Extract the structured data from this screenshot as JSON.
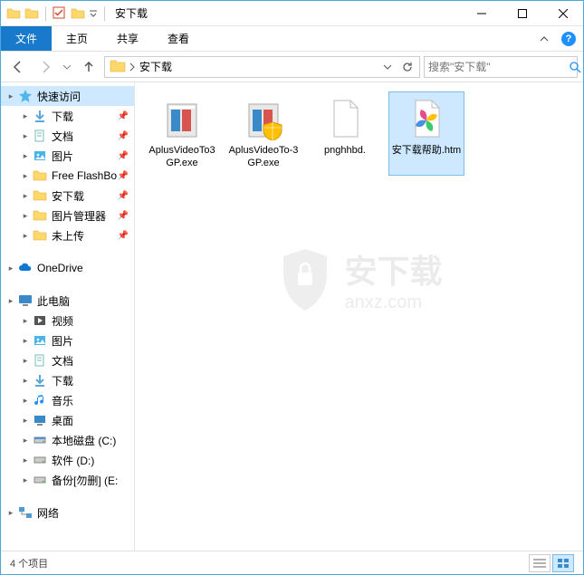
{
  "window": {
    "title": "安下载"
  },
  "ribbon": {
    "file": "文件",
    "home": "主页",
    "share": "共享",
    "view": "查看"
  },
  "address": {
    "path": "安下载",
    "search_placeholder": "搜索\"安下载\""
  },
  "sidebar": {
    "quick_access": "快速访问",
    "items_qa": [
      {
        "label": "下载",
        "icon": "download",
        "pinned": true
      },
      {
        "label": "文档",
        "icon": "documents",
        "pinned": true
      },
      {
        "label": "图片",
        "icon": "pictures",
        "pinned": true
      },
      {
        "label": "Free FlashBo",
        "icon": "folder",
        "pinned": true
      },
      {
        "label": "安下载",
        "icon": "folder",
        "pinned": true
      },
      {
        "label": "图片管理器",
        "icon": "folder",
        "pinned": true
      },
      {
        "label": "未上传",
        "icon": "folder",
        "pinned": true
      }
    ],
    "onedrive": "OneDrive",
    "this_pc": "此电脑",
    "items_pc": [
      {
        "label": "视频",
        "icon": "videos"
      },
      {
        "label": "图片",
        "icon": "pictures"
      },
      {
        "label": "文档",
        "icon": "documents"
      },
      {
        "label": "下载",
        "icon": "download"
      },
      {
        "label": "音乐",
        "icon": "music"
      },
      {
        "label": "桌面",
        "icon": "desktop"
      },
      {
        "label": "本地磁盘 (C:)",
        "icon": "drive-c"
      },
      {
        "label": "软件 (D:)",
        "icon": "drive"
      },
      {
        "label": "备份[勿删] (E:",
        "icon": "drive"
      }
    ],
    "network": "网络"
  },
  "files": [
    {
      "name": "AplusVideoTo3GP.exe",
      "type": "exe-installer"
    },
    {
      "name": "AplusVideoTo-3GP.exe",
      "type": "exe-installer-shield"
    },
    {
      "name": "pnghhbd.",
      "type": "blank"
    },
    {
      "name": "安下载帮助.htm",
      "type": "htm-pinwheel",
      "selected": true
    }
  ],
  "status": {
    "count": "4 个项目"
  },
  "watermark": {
    "title": "安下载",
    "sub": "anxz.com"
  }
}
